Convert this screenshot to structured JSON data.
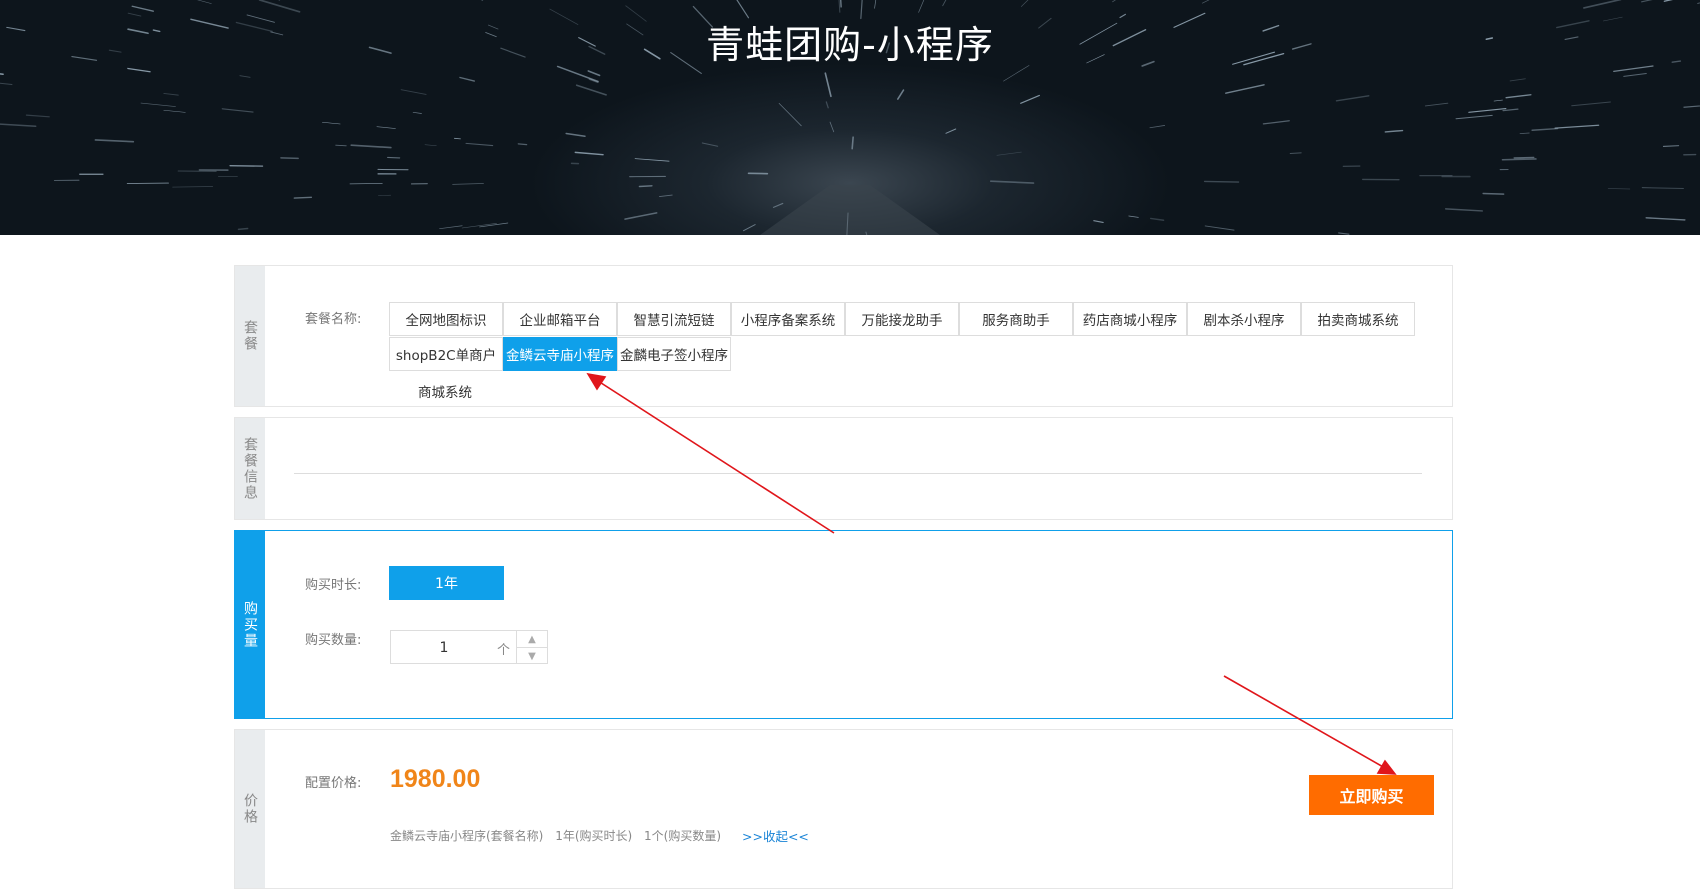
{
  "header": {
    "title": "青蛙团购-小程序"
  },
  "sections": {
    "package": "套餐",
    "package_info": "套餐信息",
    "purchase": "购买量",
    "price": "价格"
  },
  "package": {
    "label": "套餐名称:",
    "items": [
      "全网地图标识",
      "企业邮箱平台",
      "智慧引流短链",
      "小程序备案系统",
      "万能接龙助手",
      "服务商助手",
      "药店商城小程序",
      "剧本杀小程序",
      "拍卖商城系统",
      "shopB2C单商户",
      "金鳞云寺庙小程序",
      "金麟电子签小程序"
    ],
    "overflow_text": "商城系统",
    "selected_index": 10
  },
  "purchase": {
    "duration_label": "购买时长:",
    "duration_value": "1年",
    "quantity_label": "购买数量:",
    "quantity_value": "1",
    "quantity_unit": "个"
  },
  "price": {
    "label": "配置价格:",
    "amount": "1980.00",
    "summary": [
      "金鳞云寺庙小程序(套餐名称)",
      "1年(购买时长)",
      "1个(购买数量)"
    ],
    "toggle": ">>收起<<",
    "buy_button": "立即购买"
  },
  "colors": {
    "accent": "#0fa0ea",
    "price": "#f08519",
    "buy": "#ff6c00",
    "annotation": "#e0161b"
  }
}
